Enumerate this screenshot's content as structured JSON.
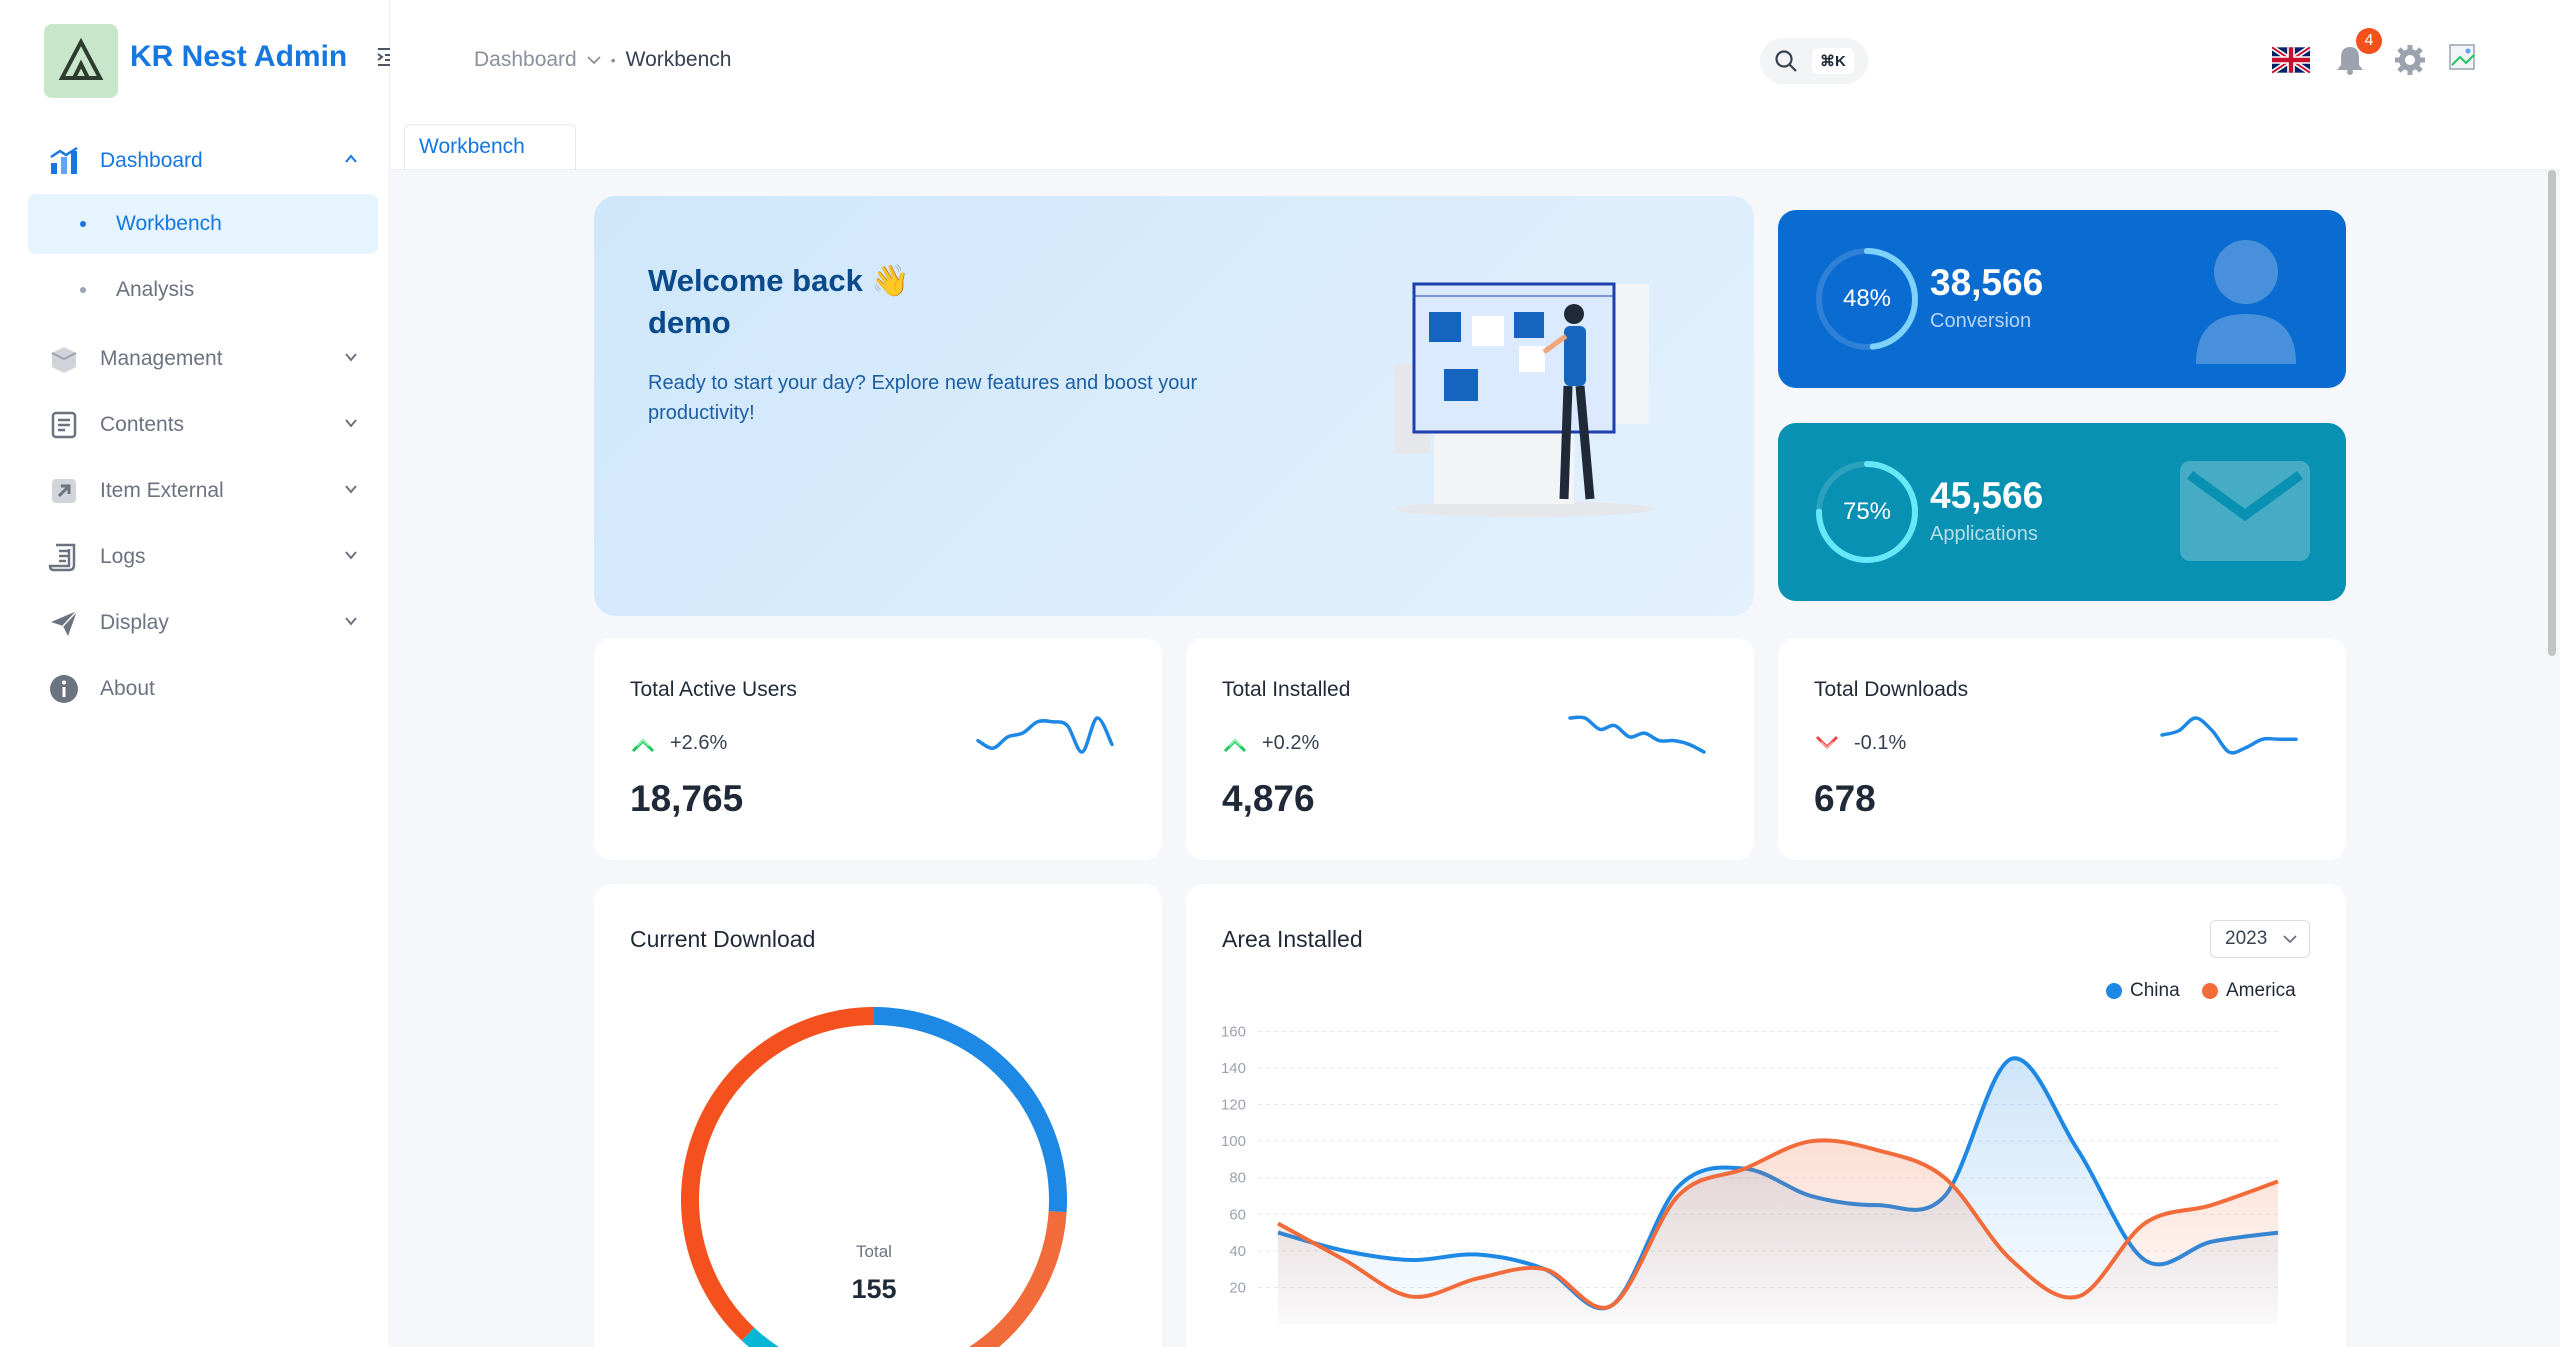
{
  "app": {
    "title": "KR Nest Admin"
  },
  "sidebar": {
    "items": [
      {
        "label": "Dashboard",
        "icon": "chart-icon"
      },
      {
        "label": "Management",
        "icon": "box-icon"
      },
      {
        "label": "Contents",
        "icon": "contents-icon"
      },
      {
        "label": "Item External",
        "icon": "external-icon"
      },
      {
        "label": "Logs",
        "icon": "logs-icon"
      },
      {
        "label": "Display",
        "icon": "paper-plane-icon"
      },
      {
        "label": "About",
        "icon": "info-icon"
      }
    ],
    "dashboard_children": [
      {
        "label": "Workbench"
      },
      {
        "label": "Analysis"
      }
    ]
  },
  "header": {
    "breadcrumb": {
      "parent": "Dashboard",
      "current": "Workbench"
    },
    "search_shortcut": "⌘K",
    "notification_count": "4"
  },
  "tabs": [
    {
      "label": "Workbench"
    }
  ],
  "welcome": {
    "title": "Welcome back 👋",
    "user": "demo",
    "message": "Ready to start your day? Explore new features and boost your productivity!"
  },
  "stats": [
    {
      "percent": "48%",
      "percent_value": 48,
      "value": "38,566",
      "label": "Conversion",
      "color": "#0a6bd1"
    },
    {
      "percent": "75%",
      "percent_value": 75,
      "value": "45,566",
      "label": "Applications",
      "color": "#0891b2"
    }
  ],
  "mini": [
    {
      "title": "Total Active Users",
      "change": "+2.6%",
      "value": "18,765",
      "trend": "up",
      "spark": [
        4,
        2,
        5,
        6,
        9,
        9,
        8,
        1,
        10,
        3
      ]
    },
    {
      "title": "Total Installed",
      "change": "+0.2%",
      "value": "4,876",
      "trend": "up",
      "spark": [
        9,
        9,
        6,
        7,
        4,
        5,
        3,
        3,
        2,
        0
      ]
    },
    {
      "title": "Total Downloads",
      "change": "-0.1%",
      "value": "678",
      "trend": "down",
      "spark": [
        5,
        6,
        9,
        6,
        1,
        2,
        4,
        4,
        4
      ]
    }
  ],
  "current_download": {
    "title": "Current Download",
    "center_label": "Total",
    "center_value": "155"
  },
  "area_installed": {
    "title": "Area Installed",
    "year": "2023",
    "legend": [
      {
        "name": "China",
        "color": "#1e88e5"
      },
      {
        "name": "America",
        "color": "#f26b3a"
      }
    ]
  },
  "chart_data": [
    {
      "type": "pie",
      "title": "Current Download",
      "segment_colors": [
        "#1e88e5",
        "#f26b3a",
        "#06b6d4",
        "#f4511e"
      ],
      "values": [
        26,
        28,
        8,
        38
      ]
    },
    {
      "type": "area",
      "title": "Area Installed",
      "ylim": [
        0,
        160
      ],
      "yticks": [
        "160",
        "140",
        "120",
        "100",
        "80",
        "60",
        "40",
        "20"
      ],
      "series": [
        {
          "name": "China",
          "values": [
            50,
            40,
            35,
            38,
            30,
            10,
            75,
            85,
            70,
            65,
            70,
            145,
            95,
            35,
            45,
            50
          ]
        },
        {
          "name": "America",
          "values": [
            55,
            35,
            15,
            25,
            30,
            10,
            70,
            85,
            100,
            95,
            80,
            35,
            15,
            55,
            65,
            78
          ]
        }
      ]
    }
  ]
}
